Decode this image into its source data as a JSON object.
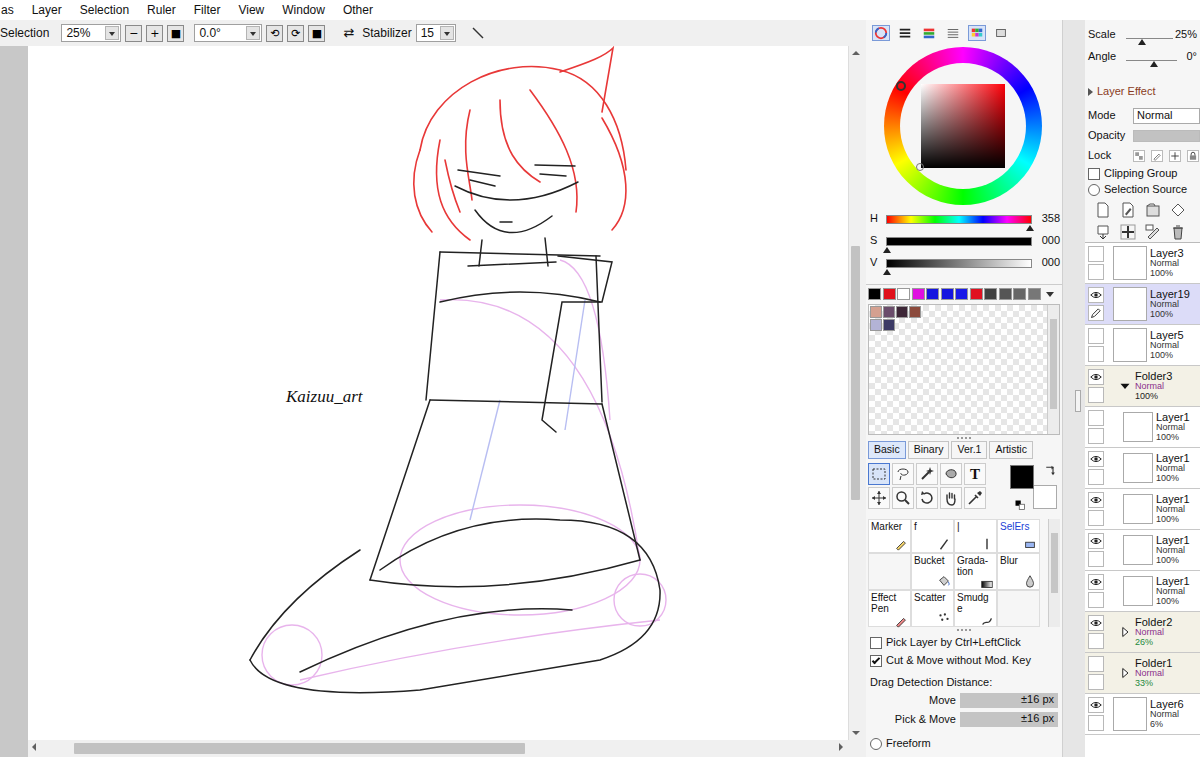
{
  "menu": [
    "as",
    "Layer",
    "Selection",
    "Ruler",
    "Filter",
    "View",
    "Window",
    "Other"
  ],
  "toolbar": {
    "label": "Selection",
    "zoom": "25%",
    "zoom_buttons": [
      "−",
      "+",
      "■"
    ],
    "angle": "0.0°",
    "rotate_buttons": [
      "⟲",
      "⟳",
      "■"
    ],
    "flip": "⇄",
    "stabilizer_label": "Stabilizer",
    "stabilizer": "15"
  },
  "canvas": {
    "signature": "Kaizuu_art",
    "vscroll": {
      "level": 0.38
    },
    "hscroll": {
      "level": 0.57
    }
  },
  "color": {
    "modes": [
      {
        "selected": true
      },
      {
        "selected": false
      },
      {
        "selected": false
      },
      {
        "selected": false
      },
      {
        "selected": true
      },
      {
        "selected": false
      }
    ],
    "hsv": [
      {
        "label": "H",
        "value": "358",
        "level": 0.994
      },
      {
        "label": "S",
        "value": "000",
        "level": 0
      },
      {
        "label": "V",
        "value": "000",
        "level": 0
      }
    ],
    "palette": [
      {
        "color": "#000000"
      },
      {
        "color": "#e0101a"
      },
      {
        "color": "#ffffff"
      },
      {
        "color": "#e010e0"
      },
      {
        "color": "#1414e0"
      },
      {
        "color": "#1414e0"
      },
      {
        "color": "#1a1ae8"
      },
      {
        "color": "#e01020"
      },
      {
        "color": "#404040"
      },
      {
        "color": "#555555"
      },
      {
        "color": "#666666"
      },
      {
        "color": "#777777"
      }
    ],
    "scratch": [
      {
        "color": "#d4a090"
      },
      {
        "color": "#6b4d6b"
      },
      {
        "color": "#3d2636"
      },
      {
        "color": "#8b4a3c"
      },
      {
        "color": "#b3b3d6"
      },
      {
        "color": "#3c3a66"
      }
    ],
    "foreground": "#000000",
    "background": "#ffffff"
  },
  "tool_tabs": [
    {
      "label": "Basic",
      "selected": true
    },
    {
      "label": "Binary",
      "selected": false
    },
    {
      "label": "Ver.1",
      "selected": false
    },
    {
      "label": "Artistic",
      "selected": false
    }
  ],
  "tools": [
    {
      "selected": true
    },
    {
      "selected": false
    },
    {
      "selected": false
    },
    {
      "selected": false
    },
    {
      "label": "T",
      "selected": false
    },
    {
      "selected": false
    },
    {
      "selected": false
    },
    {
      "selected": false
    },
    {
      "selected": false
    },
    {
      "selected": false
    }
  ],
  "brushes": [
    {
      "kind": "brush",
      "label": "Marker",
      "color": "#111111"
    },
    {
      "kind": "brush",
      "label": "f",
      "color": "#111111"
    },
    {
      "kind": "brush",
      "label": "|",
      "color": "#111111"
    },
    {
      "kind": "brush",
      "label": "SelErs",
      "color": "#1a3fd6"
    },
    {
      "kind": "empty"
    },
    {
      "kind": "brush",
      "label": "Bucket",
      "color": "#111111"
    },
    {
      "kind": "brush",
      "label": "Grada-tion",
      "color": "#111111"
    },
    {
      "kind": "brush",
      "label": "Blur",
      "color": "#111111"
    },
    {
      "kind": "brush",
      "label": "Effect Pen",
      "color": "#111111"
    },
    {
      "kind": "brush",
      "label": "Scatter",
      "color": "#111111"
    },
    {
      "kind": "brush",
      "label": "Smudge",
      "color": "#111111"
    },
    {
      "kind": "empty"
    }
  ],
  "options": {
    "checks": [
      {
        "label": "Pick Layer by Ctrl+LeftClick",
        "checked": false
      },
      {
        "label": "Cut & Move without Mod. Key",
        "checked": true
      }
    ],
    "drag_label": "Drag Detection Distance:",
    "drag": [
      {
        "label": "Move",
        "value": "±16 px"
      },
      {
        "label": "Pick & Move",
        "value": "±16 px"
      }
    ],
    "freeform": {
      "label": "Freeform",
      "selected": false
    }
  },
  "view": {
    "scale": {
      "label": "Scale",
      "value": "25%",
      "level": 0.35
    },
    "angle": {
      "label": "Angle",
      "value": "0°",
      "level": 0.55
    }
  },
  "layer_effect": {
    "label": "Layer Effect",
    "expanded": false
  },
  "mode": {
    "label": "Mode",
    "value": "Normal"
  },
  "opacity": {
    "label": "Opacity",
    "level": 1
  },
  "lock": {
    "label": "Lock",
    "items": [
      {
        "on": false
      },
      {
        "on": false
      },
      {
        "on": false
      },
      {
        "on": false
      }
    ]
  },
  "clipping": {
    "label": "Clipping Group",
    "checked": false
  },
  "selection_source": {
    "label": "Selection Source",
    "selected": false
  },
  "layers": [
    {
      "kind": "layer",
      "name": "Layer3",
      "mode": "Normal",
      "opacity": "100%",
      "visible": false,
      "selected": false,
      "editing": false
    },
    {
      "kind": "layer",
      "name": "Layer19",
      "mode": "Normal",
      "opacity": "100%",
      "visible": true,
      "selected": true,
      "editing": true
    },
    {
      "kind": "layer",
      "name": "Layer5",
      "mode": "Normal",
      "opacity": "100%",
      "visible": false,
      "selected": false,
      "editing": false
    },
    {
      "kind": "folder",
      "name": "Folder3",
      "mode": "Normal",
      "opacity": "100%",
      "visible": true,
      "selected": false,
      "expanded": true,
      "mode_color": "#8b2f8b",
      "opacity_color": "#222222",
      "children": [
        {
          "kind": "layer",
          "name": "Layer1",
          "mode": "Normal",
          "opacity": "100%",
          "visible": false,
          "selected": false,
          "editing": false
        },
        {
          "kind": "layer",
          "name": "Layer1",
          "mode": "Normal",
          "opacity": "100%",
          "visible": true,
          "selected": false,
          "editing": false
        },
        {
          "kind": "layer",
          "name": "Layer1",
          "mode": "Normal",
          "opacity": "100%",
          "visible": true,
          "selected": false,
          "editing": false
        },
        {
          "kind": "layer",
          "name": "Layer1",
          "mode": "Normal",
          "opacity": "100%",
          "visible": true,
          "selected": false,
          "editing": false
        },
        {
          "kind": "layer",
          "name": "Layer1",
          "mode": "Normal",
          "opacity": "100%",
          "visible": true,
          "selected": false,
          "editing": false
        }
      ]
    },
    {
      "kind": "folder",
      "name": "Folder2",
      "mode": "Normal",
      "opacity": "26%",
      "visible": true,
      "selected": false,
      "expanded": false,
      "mode_color": "#8b2f8b",
      "opacity_color": "#1e8a3c",
      "children": []
    },
    {
      "kind": "folder",
      "name": "Folder1",
      "mode": "Normal",
      "opacity": "33%",
      "visible": false,
      "selected": false,
      "expanded": false,
      "mode_color": "#8b2f8b",
      "opacity_color": "#1e8a3c",
      "children": []
    },
    {
      "kind": "layer",
      "name": "Layer6",
      "mode": "Normal",
      "opacity": "6%",
      "visible": true,
      "selected": false,
      "editing": false
    }
  ]
}
